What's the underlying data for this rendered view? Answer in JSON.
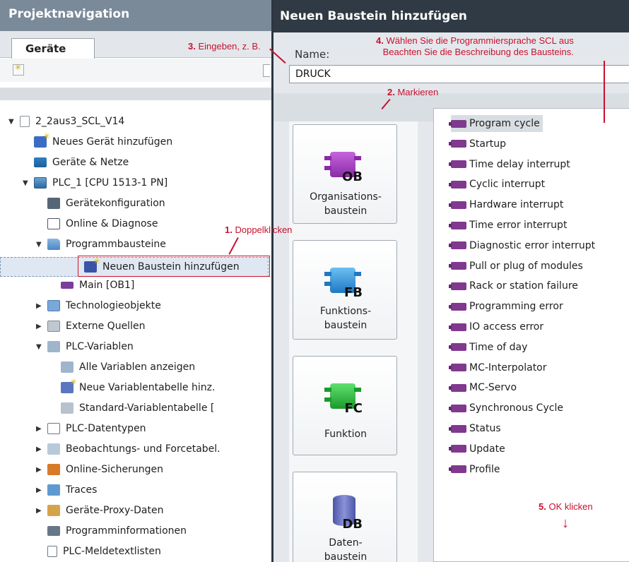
{
  "nav": {
    "title": "Projektnavigation",
    "tab": "Geräte",
    "tree": [
      {
        "label": "2_2aus3_SCL_V14",
        "arrow": "▼",
        "icon": "project-icon"
      },
      {
        "label": "Neues Gerät hinzufügen",
        "arrow": "",
        "icon": "add-device-icon"
      },
      {
        "label": "Geräte & Netze",
        "arrow": "",
        "icon": "network-icon"
      },
      {
        "label": "PLC_1 [CPU 1513-1 PN]",
        "arrow": "▼",
        "icon": "plc-icon"
      },
      {
        "label": "Gerätekonfiguration",
        "arrow": "",
        "icon": "device-config-icon"
      },
      {
        "label": "Online & Diagnose",
        "arrow": "",
        "icon": "online-diagnostics-icon"
      },
      {
        "label": "Programmbausteine",
        "arrow": "▼",
        "icon": "folder-icon"
      },
      {
        "label": "Neuen Baustein hinzufügen",
        "arrow": "",
        "icon": "add-block-icon"
      },
      {
        "label": "Main [OB1]",
        "arrow": "",
        "icon": "ob-block-icon"
      },
      {
        "label": "Technologieobjekte",
        "arrow": "▶",
        "icon": "technology-icon"
      },
      {
        "label": "Externe Quellen",
        "arrow": "▶",
        "icon": "external-source-icon"
      },
      {
        "label": "PLC-Variablen",
        "arrow": "▼",
        "icon": "tag-folder-icon"
      },
      {
        "label": "Alle Variablen anzeigen",
        "arrow": "",
        "icon": "tag-table-icon"
      },
      {
        "label": "Neue Variablentabelle hinz.",
        "arrow": "",
        "icon": "add-tag-table-icon"
      },
      {
        "label": "Standard-Variablentabelle [",
        "arrow": "",
        "icon": "default-tag-table-icon"
      },
      {
        "label": "PLC-Datentypen",
        "arrow": "▶",
        "icon": "data-types-icon"
      },
      {
        "label": "Beobachtungs- und Forcetabel.",
        "arrow": "▶",
        "icon": "watch-table-icon"
      },
      {
        "label": "Online-Sicherungen",
        "arrow": "▶",
        "icon": "online-backup-icon"
      },
      {
        "label": "Traces",
        "arrow": "▶",
        "icon": "traces-icon"
      },
      {
        "label": "Geräte-Proxy-Daten",
        "arrow": "▶",
        "icon": "device-proxy-icon"
      },
      {
        "label": "Programminformationen",
        "arrow": "",
        "icon": "program-info-icon"
      },
      {
        "label": "PLC-Meldetextlisten",
        "arrow": "",
        "icon": "alarm-text-list-icon"
      }
    ]
  },
  "dialog": {
    "title": "Neuen Baustein hinzufügen",
    "name_label": "Name:",
    "name_value": "DRUCK",
    "block_types": [
      {
        "tag": "OB",
        "label": "Organisations-\nbaustein",
        "color": "#a23cc0"
      },
      {
        "tag": "FB",
        "label": "Funktions-\nbaustein",
        "color": "#2f8fd8"
      },
      {
        "tag": "FC",
        "label": "Funktion",
        "color": "#24b43a"
      },
      {
        "tag": "DB",
        "label": "Daten-\nbaustein",
        "color": "#5a63b8"
      }
    ],
    "ob_events": [
      "Program cycle",
      "Startup",
      "Time delay interrupt",
      "Cyclic interrupt",
      "Hardware interrupt",
      "Time error interrupt",
      "Diagnostic error interrupt",
      "Pull or plug of modules",
      "Rack or station failure",
      "Programming error",
      "IO access error",
      "Time of day",
      "MC-Interpolator",
      "MC-Servo",
      "Synchronous Cycle",
      "Status",
      "Update",
      "Profile"
    ]
  },
  "annotations": {
    "a1_num": "1.",
    "a1_text": "Doppelklicken",
    "a2_num": "2.",
    "a2_text": "Markieren",
    "a3_num": "3.",
    "a3_text": "Eingeben, z. B.",
    "a4_num": "4.",
    "a4_line1": "Wählen Sie die Programmiersprache SCL aus",
    "a4_line2": "Beachten Sie die Beschreibung des Bausteins.",
    "a5_num": "5.",
    "a5_text": "OK klicken",
    "down_arrow": "↓"
  }
}
